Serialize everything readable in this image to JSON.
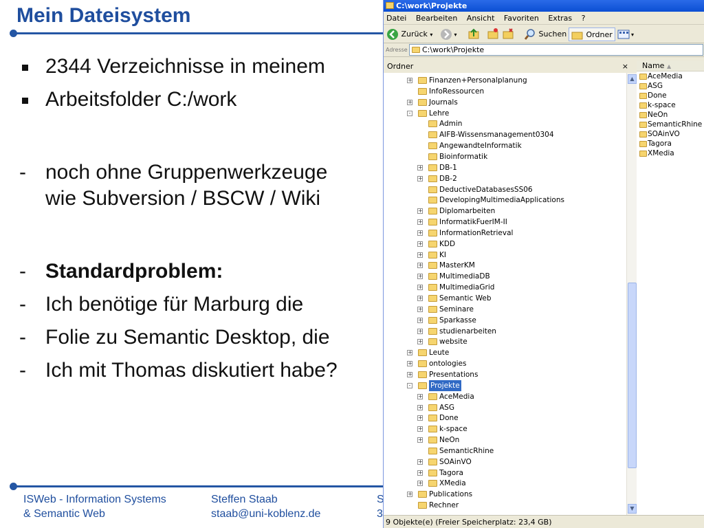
{
  "slide": {
    "title": "Mein Dateisystem",
    "bullets": [
      {
        "marker": "square",
        "text": "2344 Verzeichnisse in meinem",
        "bold": false
      },
      {
        "marker": "square",
        "text": "Arbeitsfolder C:/work",
        "bold": false
      },
      {
        "marker": "-",
        "text": "noch ohne Gruppenwerkzeuge",
        "bold": false
      },
      {
        "marker": "",
        "text": "wie Subversion / BSCW / Wiki",
        "bold": false
      },
      {
        "marker": "-",
        "text": "Standardproblem:",
        "bold": true
      },
      {
        "marker": "-",
        "text": "Ich benötige für Marburg die",
        "bold": false
      },
      {
        "marker": "-",
        "text": "Folie zu Semantic Desktop, die",
        "bold": false
      },
      {
        "marker": "-",
        "text": "Ich mit Thomas diskutiert habe?",
        "bold": false
      }
    ],
    "footer": {
      "org_line1": "ISWeb - Information Systems",
      "org_line2": "& Semantic Web",
      "author": "Steffen Staab",
      "email": "staab@uni-koblenz.de",
      "cut1": "S",
      "cut2": "3"
    }
  },
  "explorer": {
    "title": "C:\\work\\Projekte",
    "menu": [
      "Datei",
      "Bearbeiten",
      "Ansicht",
      "Favoriten",
      "Extras",
      "?"
    ],
    "toolbar": {
      "back": "Zurück",
      "search": "Suchen",
      "folders": "Ordner"
    },
    "address_label": "Adresse",
    "address": "C:\\work\\Projekte",
    "tree_header": "Ordner",
    "tree_close": "×",
    "tree": [
      {
        "label": "Finanzen+Personalplanung",
        "level": 3,
        "exp": "+"
      },
      {
        "label": "InfoRessourcen",
        "level": 3,
        "exp": ""
      },
      {
        "label": "Journals",
        "level": 3,
        "exp": "+"
      },
      {
        "label": "Lehre",
        "level": 3,
        "exp": "-"
      },
      {
        "label": "Admin",
        "level": 4,
        "exp": ""
      },
      {
        "label": "AIFB-Wissensmanagement0304",
        "level": 4,
        "exp": ""
      },
      {
        "label": "AngewandteInformatik",
        "level": 4,
        "exp": ""
      },
      {
        "label": "Bioinformatik",
        "level": 4,
        "exp": ""
      },
      {
        "label": "DB-1",
        "level": 4,
        "exp": "+"
      },
      {
        "label": "DB-2",
        "level": 4,
        "exp": "+"
      },
      {
        "label": "DeductiveDatabasesSS06",
        "level": 4,
        "exp": ""
      },
      {
        "label": "DevelopingMultimediaApplications",
        "level": 4,
        "exp": ""
      },
      {
        "label": "Diplomarbeiten",
        "level": 4,
        "exp": "+"
      },
      {
        "label": "InformatikFuerIM-II",
        "level": 4,
        "exp": "+"
      },
      {
        "label": "InformationRetrieval",
        "level": 4,
        "exp": "+"
      },
      {
        "label": "KDD",
        "level": 4,
        "exp": "+"
      },
      {
        "label": "KI",
        "level": 4,
        "exp": "+"
      },
      {
        "label": "MasterKM",
        "level": 4,
        "exp": "+"
      },
      {
        "label": "MultimediaDB",
        "level": 4,
        "exp": "+"
      },
      {
        "label": "MultimediaGrid",
        "level": 4,
        "exp": "+"
      },
      {
        "label": "Semantic Web",
        "level": 4,
        "exp": "+"
      },
      {
        "label": "Seminare",
        "level": 4,
        "exp": "+"
      },
      {
        "label": "Sparkasse",
        "level": 4,
        "exp": "+"
      },
      {
        "label": "studienarbeiten",
        "level": 4,
        "exp": "+"
      },
      {
        "label": "website",
        "level": 4,
        "exp": "+"
      },
      {
        "label": "Leute",
        "level": 3,
        "exp": "+"
      },
      {
        "label": "ontologies",
        "level": 3,
        "exp": "+"
      },
      {
        "label": "Presentations",
        "level": 3,
        "exp": "+"
      },
      {
        "label": "Projekte",
        "level": 3,
        "exp": "-",
        "selected": true
      },
      {
        "label": "AceMedia",
        "level": 4,
        "exp": "+"
      },
      {
        "label": "ASG",
        "level": 4,
        "exp": "+"
      },
      {
        "label": "Done",
        "level": 4,
        "exp": "+"
      },
      {
        "label": "k-space",
        "level": 4,
        "exp": "+"
      },
      {
        "label": "NeOn",
        "level": 4,
        "exp": "+"
      },
      {
        "label": "SemanticRhine",
        "level": 4,
        "exp": ""
      },
      {
        "label": "SOAinVO",
        "level": 4,
        "exp": "+"
      },
      {
        "label": "Tagora",
        "level": 4,
        "exp": "+"
      },
      {
        "label": "XMedia",
        "level": 4,
        "exp": "+"
      },
      {
        "label": "Publications",
        "level": 3,
        "exp": "+"
      },
      {
        "label": "Rechner",
        "level": 3,
        "exp": ""
      }
    ],
    "list_header": "Name",
    "list": [
      "AceMedia",
      "ASG",
      "Done",
      "k-space",
      "NeOn",
      "SemanticRhine",
      "SOAinVO",
      "Tagora",
      "XMedia"
    ],
    "status": "9 Objekte(e) (Freier Speicherplatz: 23,4 GB)",
    "icons": {
      "back": "back-arrow-icon",
      "forward": "forward-arrow-icon",
      "up": "folder-up-icon",
      "search": "search-icon",
      "folders": "folders-icon",
      "views": "views-icon",
      "folder": "folder-icon"
    },
    "colors": {
      "titlebar": "#0b4fd3",
      "selection": "#316ac5",
      "slide_accent": "#1f4e9e"
    }
  }
}
